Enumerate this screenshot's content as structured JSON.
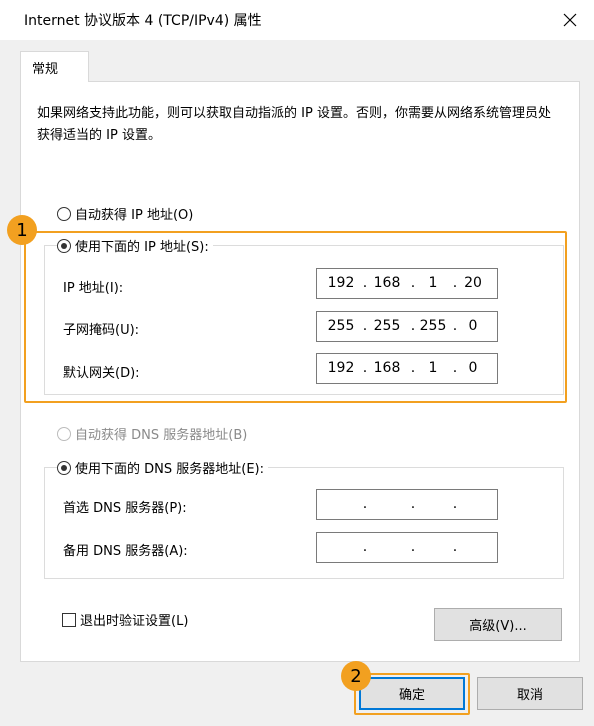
{
  "window": {
    "title": "Internet 协议版本 4 (TCP/IPv4) 属性",
    "close_icon": "close-icon"
  },
  "tabs": [
    {
      "label": "常规",
      "selected": true
    }
  ],
  "description": "如果网络支持此功能，则可以获取自动指派的 IP 设置。否则，你需要从网络系统管理员处获得适当的 IP 设置。",
  "ip": {
    "auto_label": "自动获得 IP 地址(O)",
    "manual_label": "使用下面的 IP 地址(S):",
    "selected": "manual",
    "fields": [
      {
        "label": "IP 地址(I):",
        "octets": [
          "192",
          "168",
          "1",
          "20"
        ]
      },
      {
        "label": "子网掩码(U):",
        "octets": [
          "255",
          "255",
          "255",
          "0"
        ]
      },
      {
        "label": "默认网关(D):",
        "octets": [
          "192",
          "168",
          "1",
          "0"
        ]
      }
    ]
  },
  "dns": {
    "auto_label": "自动获得 DNS 服务器地址(B)",
    "manual_label": "使用下面的 DNS 服务器地址(E):",
    "selected": "manual",
    "fields": [
      {
        "label": "首选 DNS 服务器(P):",
        "octets": [
          "",
          "",
          "",
          ""
        ]
      },
      {
        "label": "备用 DNS 服务器(A):",
        "octets": [
          "",
          "",
          "",
          ""
        ]
      }
    ]
  },
  "validate_on_exit": {
    "label": "退出时验证设置(L)",
    "checked": false
  },
  "buttons": {
    "advanced": "高级(V)...",
    "ok": "确定",
    "cancel": "取消"
  },
  "annotations": {
    "badge_1": "1",
    "badge_2": "2",
    "highlight_color": "#f2a020"
  },
  "colors": {
    "accent": "#0078d7",
    "dialog_bg": "#f0f0f0"
  }
}
